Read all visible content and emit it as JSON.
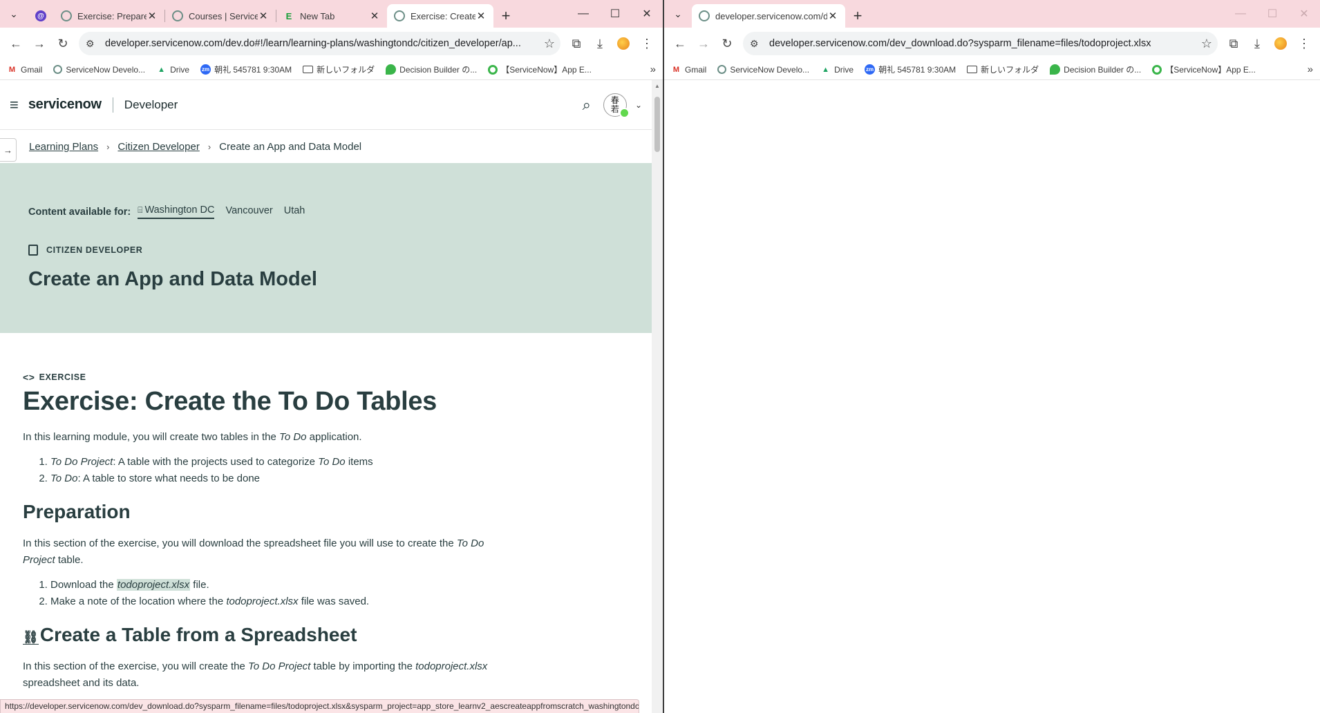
{
  "left": {
    "tabs": [
      {
        "title": "Exercise: Prepare",
        "favicon": "servicenow-icon"
      },
      {
        "title": "Courses | Service",
        "favicon": "servicenow-icon"
      },
      {
        "title": "New Tab",
        "favicon": "evernote-icon"
      },
      {
        "title": "Exercise: Create t",
        "favicon": "servicenow-icon",
        "active": true
      }
    ],
    "url": "developer.servicenow.com/dev.do#!/learn/learning-plans/washingtondc/citizen_developer/ap...",
    "status_url": "https://developer.servicenow.com/dev_download.do?sysparm_filename=files/todoproject.xlsx&sysparm_project=app_store_learnv2_aescreateappfromscratch_washingtondc"
  },
  "right": {
    "tabs": [
      {
        "title": "developer.servicenow.com/dev",
        "favicon": "servicenow-icon",
        "active": true
      }
    ],
    "url": "developer.servicenow.com/dev_download.do?sysparm_filename=files/todoproject.xlsx"
  },
  "bookmarks": [
    {
      "label": "Gmail",
      "icon": "gmail-icon"
    },
    {
      "label": "ServiceNow Develo...",
      "icon": "servicenow-icon"
    },
    {
      "label": "Drive",
      "icon": "drive-icon"
    },
    {
      "label": "朝礼 545781 9:30AM",
      "icon": "zoom-icon"
    },
    {
      "label": "新しいフォルダ",
      "icon": "folder-icon"
    },
    {
      "label": "Decision Builder の...",
      "icon": "decision-builder-icon"
    },
    {
      "label": "【ServiceNow】App E...",
      "icon": "servicenow-green-icon"
    }
  ],
  "site": {
    "logo": "servicenow",
    "section": "Developer",
    "avatar_text": "春\n若"
  },
  "breadcrumb": {
    "items": [
      "Learning Plans",
      "Citizen Developer"
    ],
    "current": "Create an App and Data Model"
  },
  "hero": {
    "available_label": "Content available for:",
    "releases": [
      "Washington DC",
      "Vancouver",
      "Utah"
    ],
    "category": "CITIZEN DEVELOPER",
    "title": "Create an App and Data Model"
  },
  "article": {
    "kind": "EXERCISE",
    "title": "Exercise: Create the To Do Tables",
    "intro": {
      "pre": "In this learning module, you will create two tables in the ",
      "em": "To Do",
      "post": " application."
    },
    "tables": [
      {
        "em": "To Do Project",
        "text": ": A table with the projects used to categorize ",
        "em2": "To Do",
        "post": " items"
      },
      {
        "em": "To Do",
        "text": ": A table to store what needs to be done"
      }
    ],
    "prep_heading": "Preparation",
    "prep_para": {
      "pre": "In this section of the exercise, you will download the spreadsheet file you will use to create the ",
      "em": "To Do Project",
      "post": " table."
    },
    "prep_steps": [
      {
        "pre": "Download the ",
        "em": "todoproject.xlsx",
        "post": " file."
      },
      {
        "pre": "Make a note of the location where the ",
        "em": "todoproject.xlsx",
        "post": " file was saved."
      }
    ],
    "create_heading": "Create a Table from a Spreadsheet",
    "create_para": {
      "pre": "In this section of the exercise, you will create the ",
      "em": "To Do Project",
      "mid": " table by importing the ",
      "em2": "todoproject.xlsx",
      "post": " spreadsheet and its data."
    }
  },
  "colors": {
    "tabstrip": "#f8d9de",
    "hero": "#cfe0d8",
    "text": "#293e40"
  }
}
